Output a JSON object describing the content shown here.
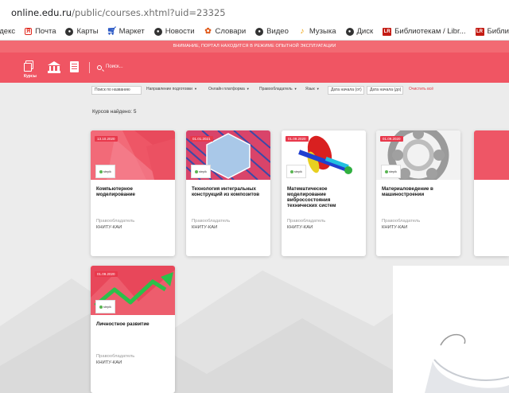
{
  "browser": {
    "url_host": "online.edu.ru",
    "url_path": "/public/courses.xhtml?uid=23325",
    "bookmarks": [
      {
        "label": "ндекс",
        "icon": "none"
      },
      {
        "label": "Почта",
        "icon": "yandex-icon"
      },
      {
        "label": "Карты",
        "icon": "globe-icon"
      },
      {
        "label": "Маркет",
        "icon": "cart-icon"
      },
      {
        "label": "Новости",
        "icon": "globe-icon"
      },
      {
        "label": "Словари",
        "icon": "dictionary-icon"
      },
      {
        "label": "Видео",
        "icon": "globe-icon"
      },
      {
        "label": "Музыка",
        "icon": "music-icon"
      },
      {
        "label": "Диск",
        "icon": "globe-icon"
      },
      {
        "label": "Библиотекам / Libr...",
        "icon": "lr-icon"
      },
      {
        "label": "Библиотеки и авто...",
        "icon": "lr-icon"
      },
      {
        "label": "Ак",
        "icon": "lr-icon"
      }
    ]
  },
  "notice": "ВНИМАНИЕ, ПОРТАЛ НАХОДИТСЯ В РЕЖИМЕ ОПЫТНОЙ ЭКСПЛУАТАЦИИ",
  "header": {
    "courses_label": "Курсы",
    "search_placeholder": "Поиск..."
  },
  "filters": {
    "name_placeholder": "Поиск по названию",
    "direction": "Направление подготовки",
    "platform": "Онлайн платформа",
    "owner": "Правообладатель",
    "language": "Язык",
    "date_from": "Дата начала (от)",
    "date_to": "Дата начала (до)",
    "clear": "Очистить всё"
  },
  "found_label": "Курсов найдено: 5",
  "logo_text": "stepik",
  "owner_label": "Правообладатель",
  "courses": [
    {
      "date": "13.10.2020",
      "title": "Компьютерное моделирование",
      "owner": "КНИТУ-КАИ"
    },
    {
      "date": "01.01.2021",
      "title": "Технология интегральных конструкций из композитов",
      "owner": "КНИТУ-КАИ"
    },
    {
      "date": "01.09.2020",
      "title": "Математическое моделирование виброссостояния технических систем",
      "owner": "КНИТУ-КАИ"
    },
    {
      "date": "01.09.2020",
      "title": "Материаловедение в машиностроении",
      "owner": "КНИТУ-КАИ"
    },
    {
      "date": "01.09.2020",
      "title": "Личностное развитие",
      "owner": "КНИТУ-КАИ"
    }
  ],
  "colors": {
    "brand": "#f05563",
    "notice": "#f26a73",
    "date_badge": "#e8384b",
    "background": "#ececec"
  }
}
